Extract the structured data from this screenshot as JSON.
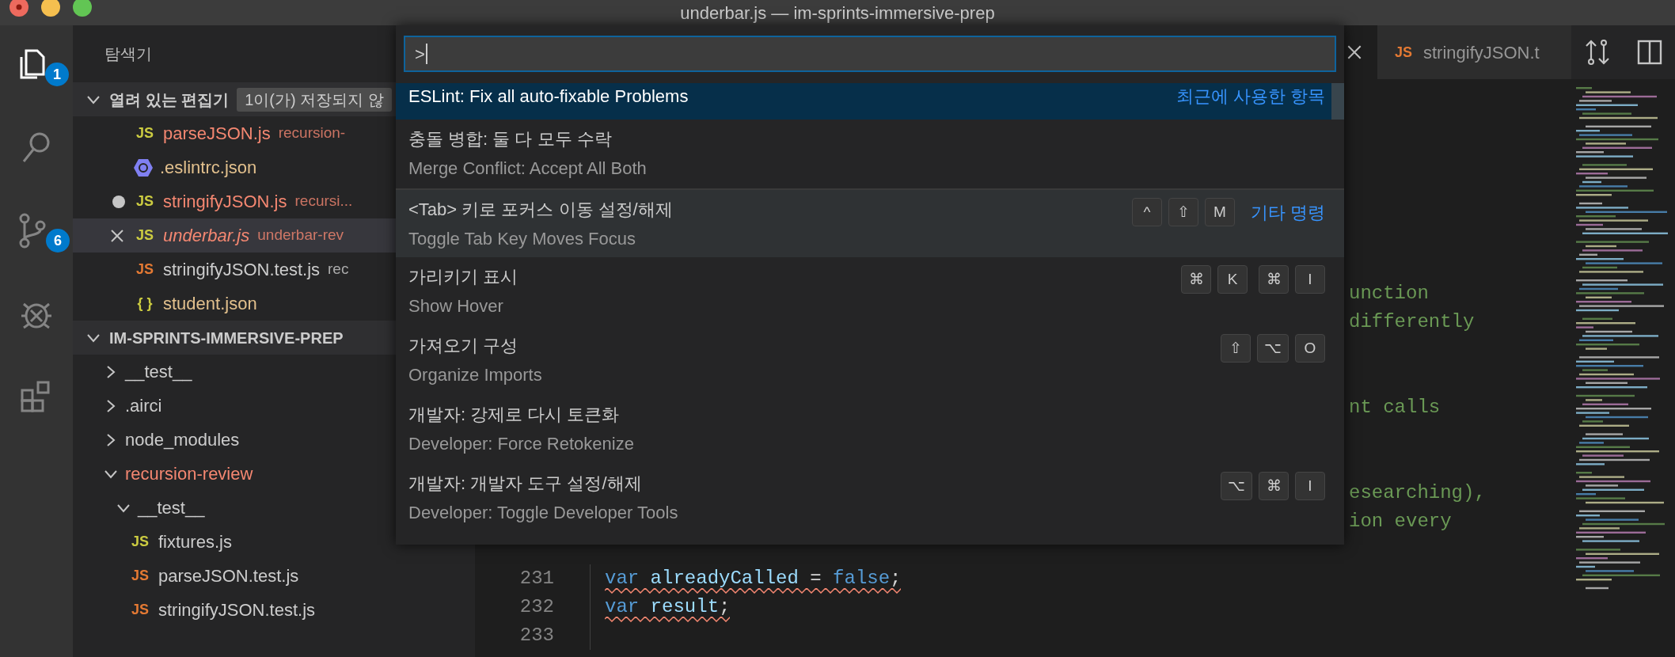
{
  "window": {
    "title": "underbar.js — im-sprints-immersive-prep"
  },
  "activity_bar": [
    {
      "kind": "explorer",
      "selected": true,
      "badge": "1"
    },
    {
      "kind": "search",
      "selected": false
    },
    {
      "kind": "source-control",
      "selected": false,
      "badge": "6"
    },
    {
      "kind": "debug",
      "selected": false
    },
    {
      "kind": "extensions",
      "selected": false
    }
  ],
  "sidebar": {
    "title": "탐색기",
    "open_editors": {
      "title": "열려 있는 편집기",
      "expanded": true,
      "badge": "1이(가) 저장되지 않",
      "items": [
        {
          "kind": "js",
          "icon_glyph": "JS",
          "name": "parseJSON.js",
          "description": "recursion-",
          "color": "#f48771",
          "dirty": false,
          "hovered": false,
          "preview": false
        },
        {
          "kind": "eslint",
          "name": ".eslintrc.json",
          "color": "#e2c08d",
          "dirty": false,
          "hovered": false,
          "preview": false
        },
        {
          "kind": "js",
          "icon_glyph": "JS",
          "name": "stringifyJSON.js",
          "description": "recursi...",
          "color": "#f48771",
          "dirty": true,
          "hovered": false,
          "preview": false
        },
        {
          "kind": "js",
          "icon_glyph": "JS",
          "name": "underbar.js",
          "description": "underbar-rev",
          "color": "#f48771",
          "dirty": false,
          "hovered": true,
          "preview": true
        },
        {
          "kind": "test-js",
          "icon_glyph": "JS",
          "name": "stringifyJSON.test.js",
          "description": "rec",
          "color": "#cccccc",
          "dirty": false,
          "hovered": false,
          "preview": false
        },
        {
          "kind": "json",
          "icon_glyph": "{ }",
          "name": "student.json",
          "color": "#e2c08d",
          "dirty": false,
          "hovered": false,
          "preview": false
        }
      ]
    },
    "folder": {
      "title": "IM-SPRINTS-IMMERSIVE-PREP",
      "expanded": true,
      "children": [
        {
          "kind": "folder",
          "name": "__test__",
          "expanded": false,
          "color": "#cccccc"
        },
        {
          "kind": "folder",
          "name": ".airci",
          "expanded": false,
          "color": "#cccccc"
        },
        {
          "kind": "folder",
          "name": "node_modules",
          "expanded": false,
          "color": "#cccccc"
        },
        {
          "kind": "folder",
          "name": "recursion-review",
          "expanded": true,
          "color": "#f48771",
          "children": [
            {
              "kind": "folder",
              "name": "__test__",
              "expanded": true,
              "color": "#cccccc",
              "children": [
                {
                  "kind": "js",
                  "name": "fixtures.js",
                  "icon_glyph": "JS",
                  "color": "#cccccc"
                },
                {
                  "kind": "test-js",
                  "name": "parseJSON.test.js",
                  "icon_glyph": "JS",
                  "color": "#cccccc"
                },
                {
                  "kind": "test-js",
                  "name": "stringifyJSON.test.js",
                  "icon_glyph": "JS",
                  "color": "#cccccc"
                }
              ]
            }
          ]
        }
      ]
    }
  },
  "editor": {
    "tabs": [
      {
        "selected": true
      },
      {
        "label": "stringifyJSON.t",
        "kind": "test-js",
        "icon_glyph": "JS",
        "selected": false
      }
    ],
    "line_fragments": [
      "unction",
      "differently",
      "nt calls",
      "esearching),",
      "ion every"
    ],
    "lines": [
      {
        "number": "231",
        "tokens": [
          {
            "color": "#569cd6",
            "text": "var"
          },
          {
            "color": "#9cdcfe",
            "text": " alreadyCalled"
          },
          {
            "color": "#d4d4d4",
            "text": " = "
          },
          {
            "color": "#569cd6",
            "text": "false"
          },
          {
            "color": "#d4d4d4",
            "text": ";"
          }
        ],
        "squiggle": true
      },
      {
        "number": "232",
        "tokens": [
          {
            "color": "#569cd6",
            "text": "var"
          },
          {
            "color": "#9cdcfe",
            "text": " result"
          },
          {
            "color": "#d4d4d4",
            "text": ";"
          }
        ],
        "squiggle": true
      },
      {
        "number": "233"
      }
    ]
  },
  "command_palette": {
    "input": {
      "value": ">"
    },
    "items": [
      {
        "label": "ESLint: Fix all auto-fixable Problems",
        "group_label": "최근에 사용한 항목",
        "selected": true,
        "hovered": false,
        "separator": false
      },
      {
        "label": "충돌 병합: 둘 다 모두 수락",
        "detail": "Merge Conflict: Accept All Both",
        "selected": false,
        "hovered": false,
        "separator": false
      },
      {
        "label": "<Tab> 키로 포커스 이동 설정/해제",
        "detail": "Toggle Tab Key Moves Focus",
        "keys": [
          [
            "^",
            "⇧",
            "M"
          ]
        ],
        "group_label": "기타 명령",
        "selected": false,
        "hovered": true,
        "separator": true
      },
      {
        "label": "가리키기 표시",
        "detail": "Show Hover",
        "keys": [
          [
            "⌘",
            "K"
          ],
          [
            "⌘",
            "I"
          ]
        ],
        "selected": false,
        "hovered": false,
        "separator": false
      },
      {
        "label": "가져오기 구성",
        "detail": "Organize Imports",
        "keys": [
          [
            "⇧",
            "⌥",
            "O"
          ]
        ],
        "selected": false,
        "hovered": false,
        "separator": false
      },
      {
        "label": "개발자: 강제로 다시 토큰화",
        "detail": "Developer: Force Retokenize",
        "selected": false,
        "hovered": false,
        "separator": false
      },
      {
        "label": "개발자: 개발자 도구 설정/해제",
        "detail": "Developer: Toggle Developer Tools",
        "keys": [
          [
            "⌥",
            "⌘",
            "I"
          ]
        ],
        "selected": false,
        "hovered": false,
        "separator": false
      }
    ]
  }
}
